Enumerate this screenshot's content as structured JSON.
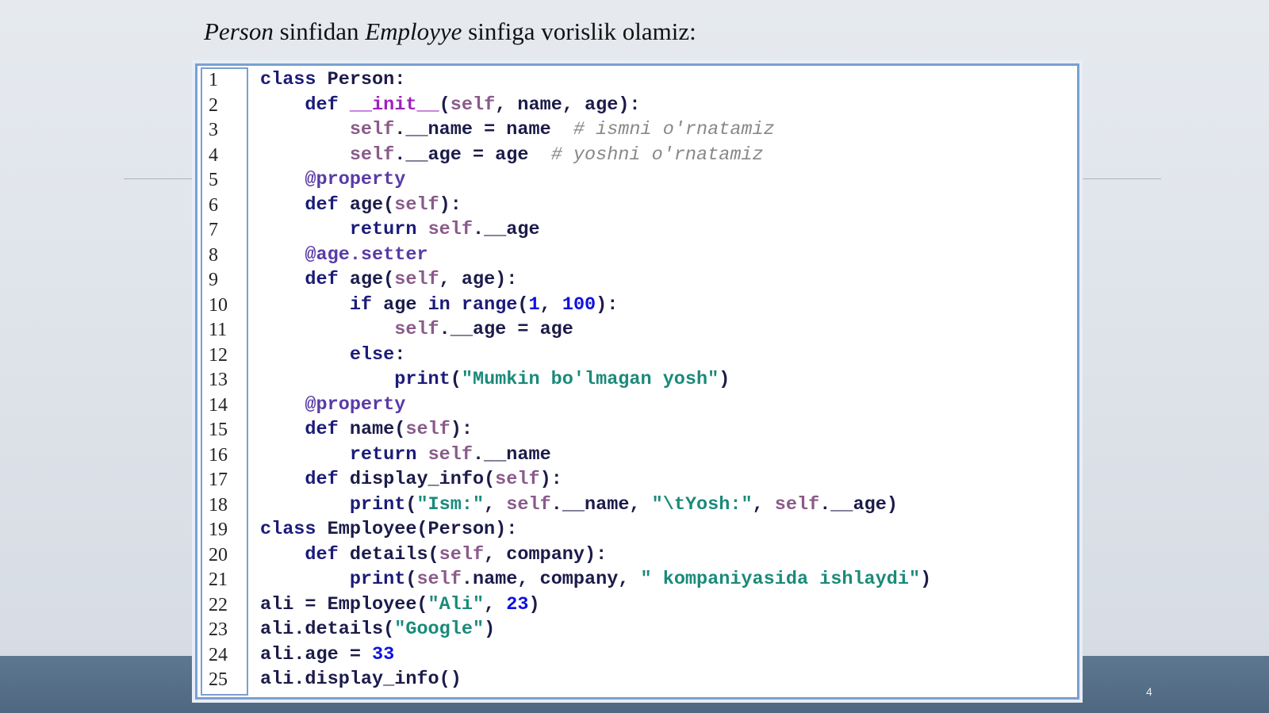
{
  "title": {
    "part1_em": "Person",
    "part2": " sinfidan ",
    "part3_em": "Employye",
    "part4": " sinfiga vorislik olamiz:"
  },
  "code": {
    "language": "python",
    "lines": [
      {
        "n": "1",
        "text": "class Person:"
      },
      {
        "n": "2",
        "text": "    def __init__(self, name, age):"
      },
      {
        "n": "3",
        "text": "        self.__name = name  # ismni o'rnatamiz"
      },
      {
        "n": "4",
        "text": "        self.__age = age  # yoshni o'rnatamiz"
      },
      {
        "n": "5",
        "text": "    @property"
      },
      {
        "n": "6",
        "text": "    def age(self):"
      },
      {
        "n": "7",
        "text": "        return self.__age"
      },
      {
        "n": "8",
        "text": "    @age.setter"
      },
      {
        "n": "9",
        "text": "    def age(self, age):"
      },
      {
        "n": "10",
        "text": "        if age in range(1, 100):"
      },
      {
        "n": "11",
        "text": "            self.__age = age"
      },
      {
        "n": "12",
        "text": "        else:"
      },
      {
        "n": "13",
        "text": "            print(\"Mumkin bo'lmagan yosh\")"
      },
      {
        "n": "14",
        "text": "    @property"
      },
      {
        "n": "15",
        "text": "    def name(self):"
      },
      {
        "n": "16",
        "text": "        return self.__name"
      },
      {
        "n": "17",
        "text": "    def display_info(self):"
      },
      {
        "n": "18",
        "text": "        print(\"Ism:\", self.__name, \"\\tYosh:\", self.__age)"
      },
      {
        "n": "19",
        "text": "class Employee(Person):"
      },
      {
        "n": "20",
        "text": "    def details(self, company):"
      },
      {
        "n": "21",
        "text": "        print(self.name, company, \" kompaniyasida ishlaydi\")"
      },
      {
        "n": "22",
        "text": "ali = Employee(\"Ali\", 23)"
      },
      {
        "n": "23",
        "text": "ali.details(\"Google\")"
      },
      {
        "n": "24",
        "text": "ali.age = 33"
      },
      {
        "n": "25",
        "text": "ali.display_info()"
      }
    ]
  },
  "colors": {
    "keyword": "#1b1b7a",
    "self": "#8a5a8a",
    "decorator": "#5a3aa8",
    "number": "#1010e0",
    "string": "#1a8a7a",
    "comment": "#888888",
    "magic_method": "#a020c0",
    "code_border": "#7aa0d0"
  },
  "page_number": "4"
}
